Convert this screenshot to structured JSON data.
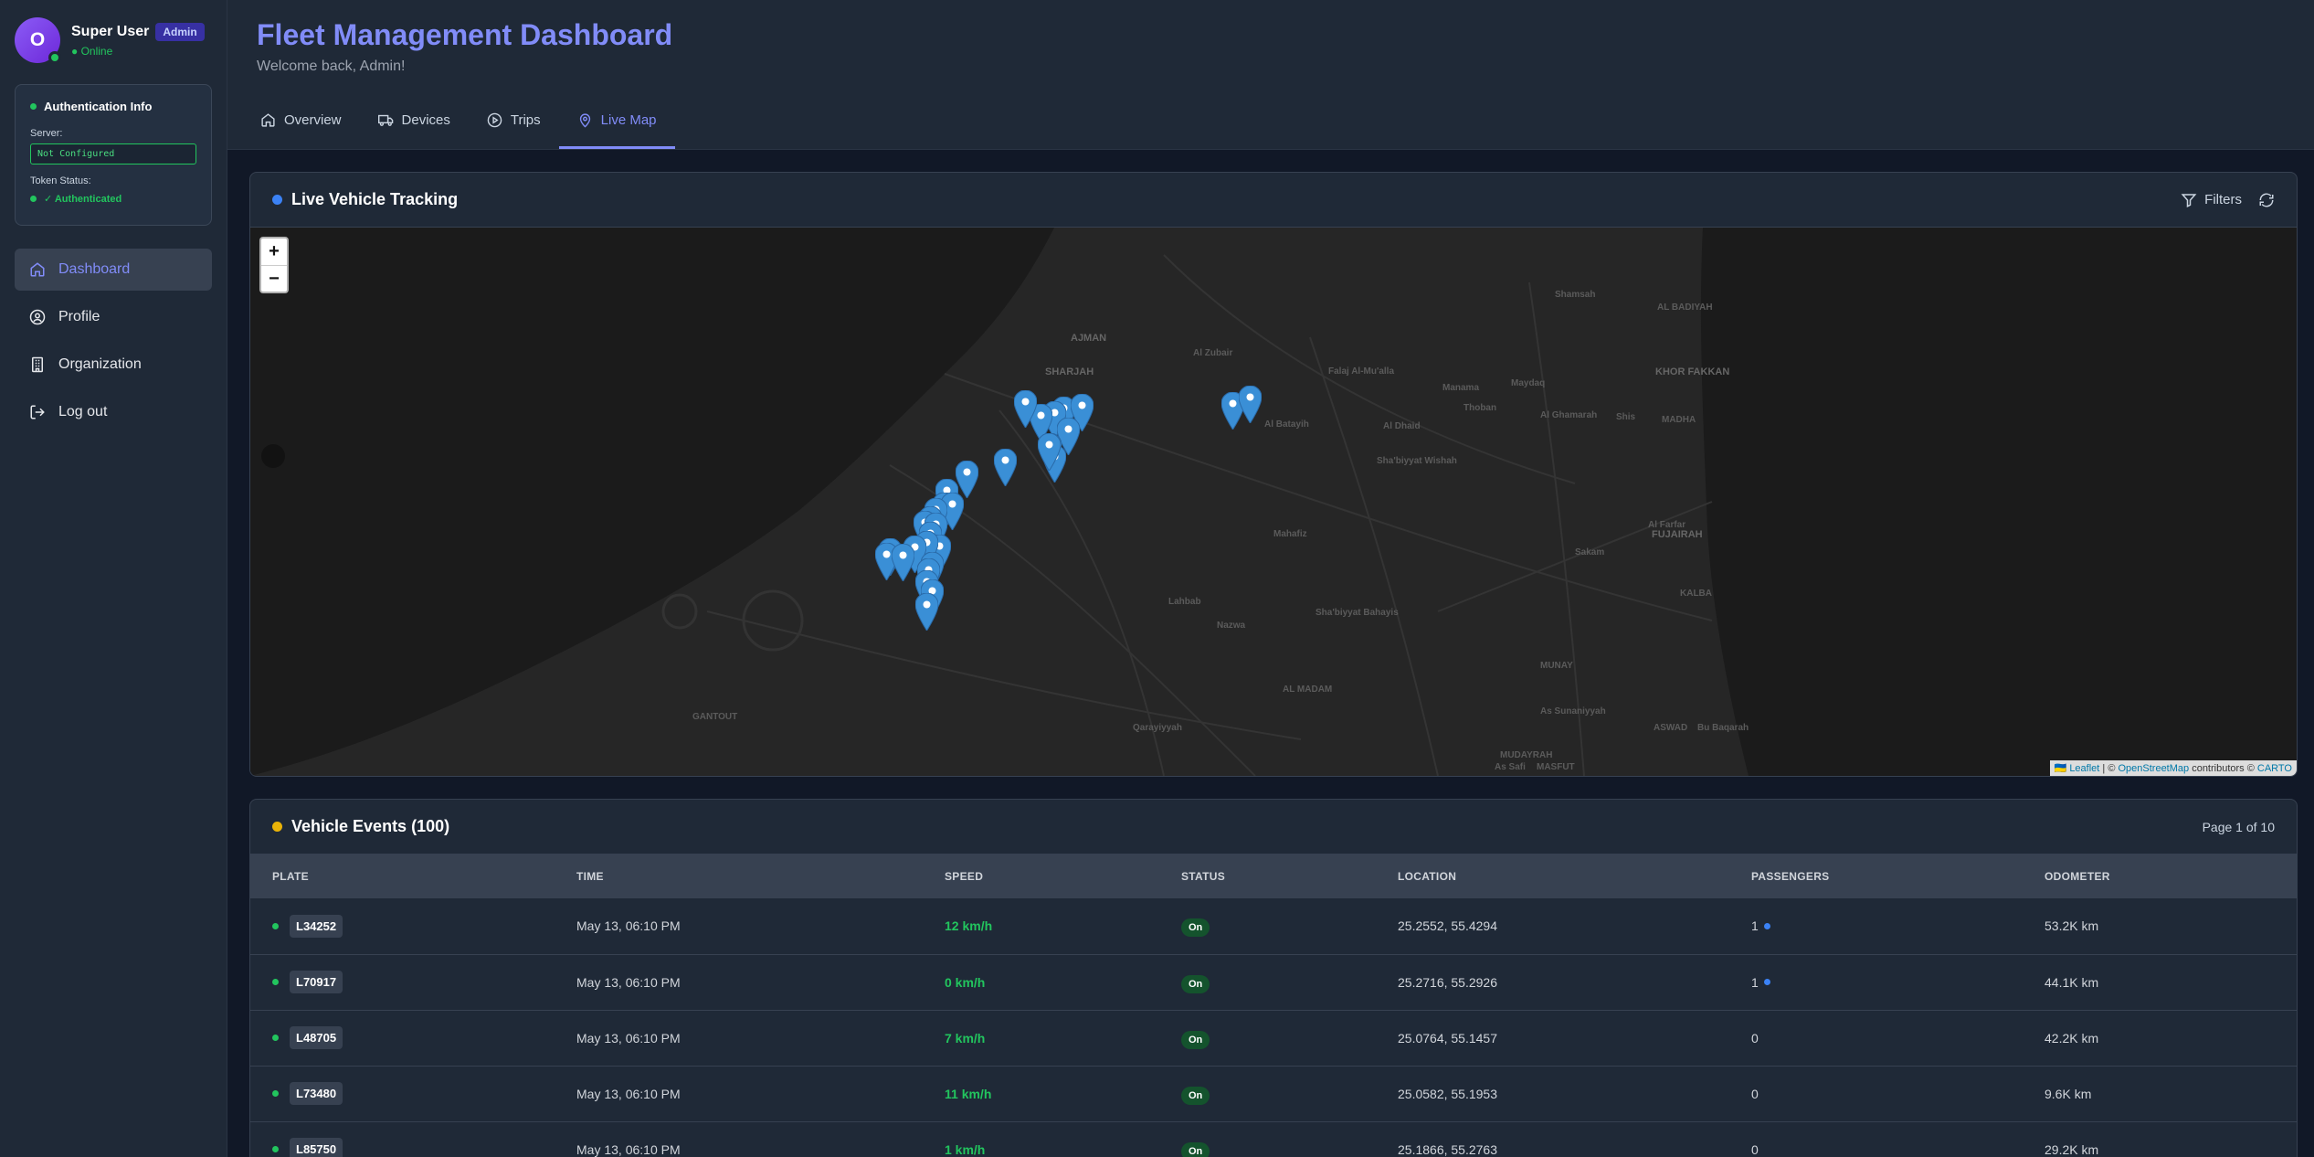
{
  "user": {
    "initial": "O",
    "name": "Super User",
    "role": "Admin",
    "status": "● Online"
  },
  "auth": {
    "title": "Authentication Info",
    "server_label": "Server:",
    "server_value": "Not Configured",
    "token_label": "Token Status:",
    "token_value": "✓ Authenticated"
  },
  "nav": [
    {
      "label": "Dashboard",
      "icon": "home-icon",
      "active": true
    },
    {
      "label": "Profile",
      "icon": "user-circle-icon",
      "active": false
    },
    {
      "label": "Organization",
      "icon": "building-icon",
      "active": false
    },
    {
      "label": "Log out",
      "icon": "logout-icon",
      "active": false
    }
  ],
  "header": {
    "title": "Fleet Management Dashboard",
    "subtitle": "Welcome back, Admin!"
  },
  "tabs": [
    {
      "label": "Overview",
      "icon": "home-icon"
    },
    {
      "label": "Devices",
      "icon": "truck-icon"
    },
    {
      "label": "Trips",
      "icon": "play-circle-icon"
    },
    {
      "label": "Live Map",
      "icon": "map-pin-icon",
      "active": true
    }
  ],
  "map_card": {
    "title": "Live Vehicle Tracking",
    "filters_label": "Filters",
    "zoom_in": "+",
    "zoom_out": "−",
    "attribution": {
      "leaflet": "🇺🇦 Leaflet",
      "sep": " | © ",
      "osm": "OpenStreetMap",
      "contrib": " contributors © ",
      "carto": "CARTO"
    },
    "places": [
      {
        "name": "AJMAN",
        "big": true
      },
      {
        "name": "SHARJAH",
        "big": true
      },
      {
        "name": "Al Zubair"
      },
      {
        "name": "Falaj Al-Mu'alla"
      },
      {
        "name": "Manama"
      },
      {
        "name": "Maydaq"
      },
      {
        "name": "Shamsah"
      },
      {
        "name": "AL BADIYAH"
      },
      {
        "name": "Thoban"
      },
      {
        "name": "Al Ghamarah"
      },
      {
        "name": "KHOR FAKKAN",
        "big": true
      },
      {
        "name": "Al Batayih"
      },
      {
        "name": "Al Dhaid"
      },
      {
        "name": "Sha'biyyat Wishah"
      },
      {
        "name": "Shis"
      },
      {
        "name": "MADHA"
      },
      {
        "name": "Mahafiz"
      },
      {
        "name": "Al Farfar"
      },
      {
        "name": "FUJAIRAH",
        "big": true
      },
      {
        "name": "Sakam"
      },
      {
        "name": "KALBA"
      },
      {
        "name": "Lahbab"
      },
      {
        "name": "Sha'biyyat Bahayis"
      },
      {
        "name": "Nazwa"
      },
      {
        "name": "MUNAY"
      },
      {
        "name": "AL MADAM"
      },
      {
        "name": "GANTOUT"
      },
      {
        "name": "As Sunaniyyah"
      },
      {
        "name": "Qarayiyyah"
      },
      {
        "name": "ASWAD"
      },
      {
        "name": "Bu Baqarah"
      },
      {
        "name": "MUDAYRAH"
      },
      {
        "name": "As Safi"
      },
      {
        "name": "MASFUT"
      }
    ]
  },
  "events": {
    "title": "Vehicle Events (100)",
    "page_info": "Page 1 of 10",
    "columns": [
      "PLATE",
      "TIME",
      "SPEED",
      "STATUS",
      "LOCATION",
      "PASSENGERS",
      "ODOMETER"
    ],
    "rows": [
      {
        "plate": "L34252",
        "time": "May 13, 06:10 PM",
        "speed": "12 km/h",
        "status": "On",
        "location": "25.2552, 55.4294",
        "passengers": "1",
        "pass_dot": true,
        "odometer": "53.2K km"
      },
      {
        "plate": "L70917",
        "time": "May 13, 06:10 PM",
        "speed": "0 km/h",
        "status": "On",
        "location": "25.2716, 55.2926",
        "passengers": "1",
        "pass_dot": true,
        "odometer": "44.1K km"
      },
      {
        "plate": "L48705",
        "time": "May 13, 06:10 PM",
        "speed": "7 km/h",
        "status": "On",
        "location": "25.0764, 55.1457",
        "passengers": "0",
        "pass_dot": false,
        "odometer": "42.2K km"
      },
      {
        "plate": "L73480",
        "time": "May 13, 06:10 PM",
        "speed": "11 km/h",
        "status": "On",
        "location": "25.0582, 55.1953",
        "passengers": "0",
        "pass_dot": false,
        "odometer": "9.6K km"
      },
      {
        "plate": "L85750",
        "time": "May 13, 06:10 PM",
        "speed": "1 km/h",
        "status": "On",
        "location": "25.1866, 55.2763",
        "passengers": "0",
        "pass_dot": false,
        "odometer": "29.2K km"
      }
    ]
  },
  "colors": {
    "accent": "#818cf8",
    "online": "#22c55e",
    "marker": "#3a8fd6",
    "panel": "#1f2937"
  }
}
